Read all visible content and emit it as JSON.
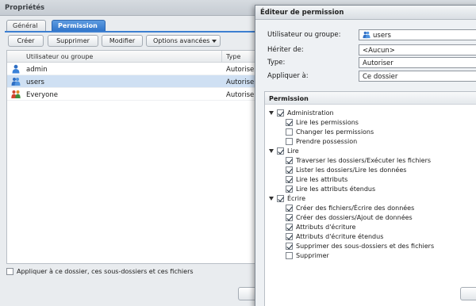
{
  "back_window": {
    "title": "Propriétés",
    "tabs": [
      {
        "label": "Général"
      },
      {
        "label": "Permission"
      }
    ],
    "toolbar": {
      "create_label": "Créer",
      "delete_label": "Supprimer",
      "modify_label": "Modifier",
      "advanced_label": "Options avancées"
    },
    "table": {
      "headers": [
        "Utilisateur ou groupe",
        "Type"
      ],
      "rows": [
        {
          "name": "admin",
          "type": "Autoriser",
          "icon": "user-icon"
        },
        {
          "name": "users",
          "type": "Autoriser",
          "icon": "group-icon"
        },
        {
          "name": "Everyone",
          "type": "Autoriser",
          "icon": "everyone-icon"
        }
      ]
    },
    "apply_all_label": "Appliquer à ce dossier, ces sous-dossiers et ces fichiers"
  },
  "dialog": {
    "title": "Éditeur de permission",
    "fields": {
      "user_label": "Utilisateur ou groupe:",
      "user_value": "users",
      "inherit_label": "Hériter de:",
      "inherit_value": "<Aucun>",
      "type_label": "Type:",
      "type_value": "Autoriser",
      "apply_label": "Appliquer à:",
      "apply_value": "Ce dossier"
    },
    "permission_header": "Permission",
    "groups": [
      {
        "label": "Administration",
        "checked": true,
        "items": [
          {
            "label": "Lire les permissions",
            "checked": true
          },
          {
            "label": "Changer les permissions",
            "checked": false
          },
          {
            "label": "Prendre possession",
            "checked": false
          }
        ]
      },
      {
        "label": "Lire",
        "checked": true,
        "items": [
          {
            "label": "Traverser les dossiers/Exécuter les fichiers",
            "checked": true
          },
          {
            "label": "Lister les dossiers/Lire les données",
            "checked": true
          },
          {
            "label": "Lire les attributs",
            "checked": true
          },
          {
            "label": "Lire les attributs étendus",
            "checked": true
          }
        ]
      },
      {
        "label": "Écrire",
        "checked": true,
        "items": [
          {
            "label": "Créer des fichiers/Écrire des données",
            "checked": true
          },
          {
            "label": "Créer des dossiers/Ajout de données",
            "checked": true
          },
          {
            "label": "Attributs d'écriture",
            "checked": true
          },
          {
            "label": "Attributs d'écriture étendus",
            "checked": true
          },
          {
            "label": "Supprimer des sous-dossiers et des fichiers",
            "checked": true
          },
          {
            "label": "Supprimer",
            "checked": false
          }
        ]
      }
    ]
  },
  "colors": {
    "accent": "#2f73c9",
    "selection": "#cfe0f3",
    "backdrop": "#8e8e8e"
  }
}
